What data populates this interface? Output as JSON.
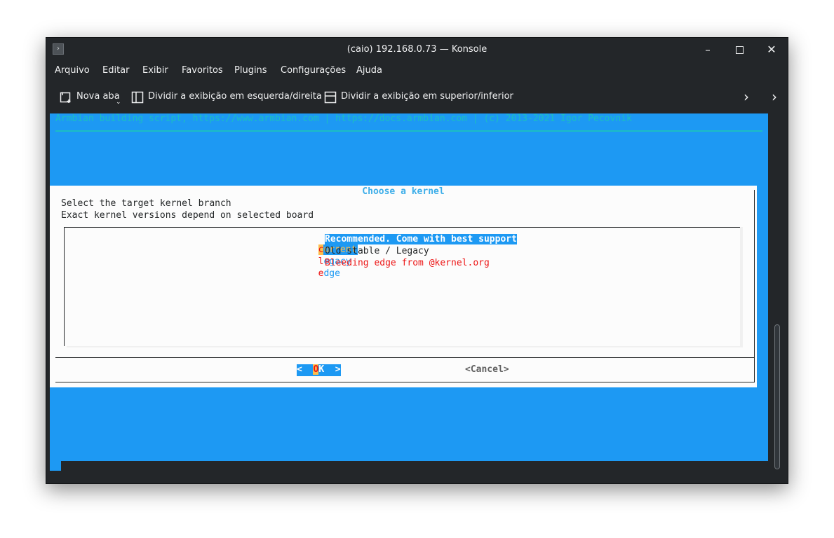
{
  "window": {
    "title": "(caio) 192.168.0.73 — Konsole"
  },
  "menubar": {
    "items": [
      "Arquivo",
      "Editar",
      "Exibir",
      "Favoritos",
      "Plugins",
      "Configurações",
      "Ajuda"
    ]
  },
  "toolbar": {
    "new_tab_label": "Nova aba",
    "split_lr_label": "Dividir a exibição em esquerda/direita",
    "split_tb_label": "Dividir a exibição em superior/inferior"
  },
  "terminal": {
    "banner": "Armbian building script, https://www.armbian.com | https://docs.armbian.com | (c) 2013-2021 Igor Pecovnik",
    "dialog": {
      "title": " Choose a kernel ",
      "line1": "Select the target kernel branch",
      "line2": "Exact kernel versions depend on selected board",
      "options": [
        {
          "hotkey": "c",
          "rest": "urrent",
          "description": "Recommended. Come with best support"
        },
        {
          "hotkey": "l",
          "rest": "egacy",
          "description": "Old stable / Legacy"
        },
        {
          "hotkey": "e",
          "rest": "dge",
          "description": "Bleeding edge from @kernel.org"
        }
      ],
      "ok_left": "<  ",
      "ok_hot": "O",
      "ok_right": "K  >",
      "cancel": "<Cancel>"
    }
  },
  "colors": {
    "terminal_bg": "#1d99f3",
    "dialog_bg": "#fcfcfc",
    "hotkey": "#ed1515",
    "highlight": "#fdbc4b",
    "window_chrome": "#232629"
  }
}
